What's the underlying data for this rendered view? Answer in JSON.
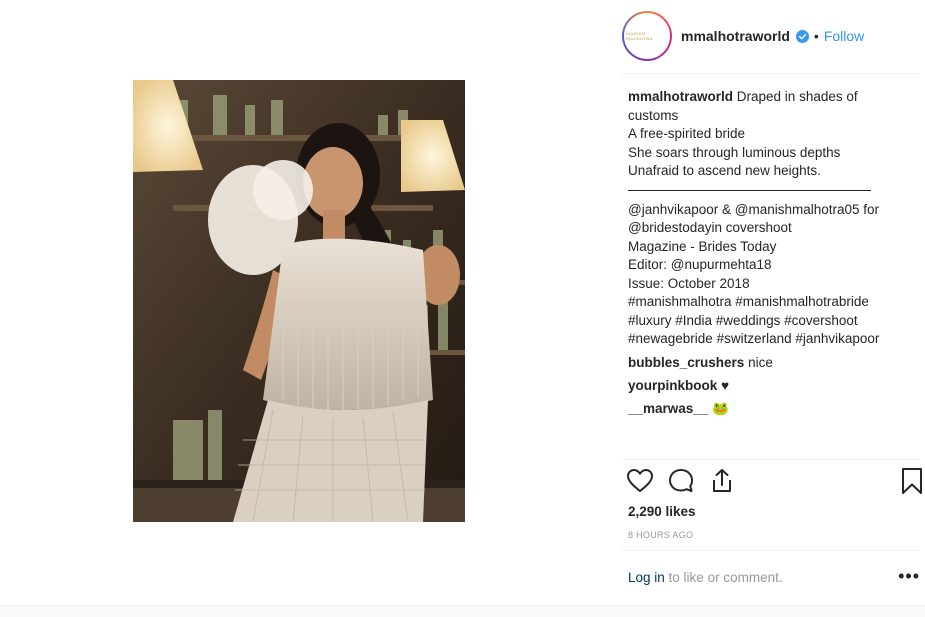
{
  "post": {
    "username": "mmalhotraworld",
    "follow_label": "Follow",
    "dot": "•",
    "avatar_text": "MANISH MALHOTRA"
  },
  "caption": {
    "user": "mmalhotraworld",
    "lines": [
      "Draped in shades of",
      "customs",
      "A free-spirited bride",
      "She soars through luminous depths",
      "Unafraid to ascend new heights.",
      "@janhvikapoor & @manishmalhotra05 for",
      "@bridestodayin covershoot",
      "Magazine - Brides Today",
      "Editor: @nupurmehta18",
      "Issue: October 2018",
      "#manishmalhotra #manishmalhotrabride",
      "#luxury #India #weddings #covershoot",
      "#newagebride #switzerland #janhvikapoor"
    ]
  },
  "comments": [
    {
      "user": "bubbles_crushers",
      "text": "nice"
    },
    {
      "user": "yourpinkbook",
      "text": "♥"
    },
    {
      "user": "__marwas__",
      "text": "🐸"
    }
  ],
  "stats": {
    "likes": "2,290 likes",
    "time": "8 HOURS AGO"
  },
  "footer": {
    "login_link": "Log in",
    "login_rest": " to like or comment.",
    "more": "•••"
  },
  "colors": {
    "accent": "#3897f0",
    "text": "#262626",
    "muted": "#999999"
  },
  "icons": [
    "heart-icon",
    "comment-icon",
    "share-icon",
    "bookmark-icon",
    "verified-badge-icon",
    "more-options-icon"
  ]
}
